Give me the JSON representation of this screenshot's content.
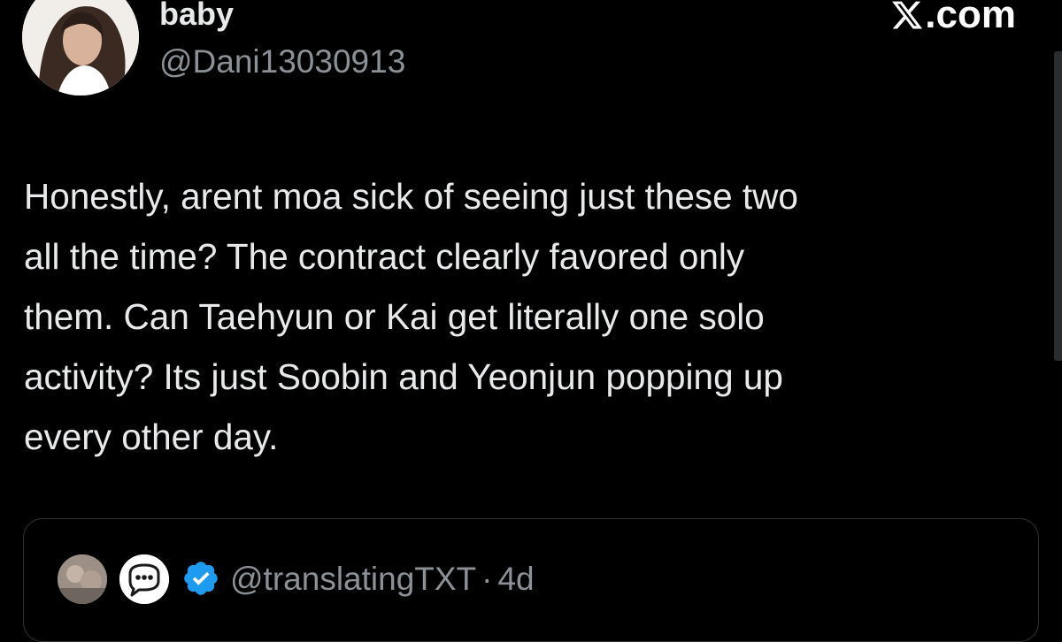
{
  "tweet": {
    "author": {
      "display_name": "baby",
      "handle": "@Dani13030913",
      "avatar_icon": "profile-photo"
    },
    "brand": {
      "logo_icon": "x-logo-icon",
      "domain_suffix": ".com"
    },
    "text": "Honestly, arent moa sick of seeing just these two\nall the time? The contract clearly favored only\nthem. Can Taehyun or Kai get literally one solo\nactivity? Its just Soobin and Yeonjun popping up\nevery other day."
  },
  "quoted_tweet": {
    "handle": "@translatingTXT",
    "separator": "·",
    "age": "4d",
    "verified": true,
    "verified_color": "#1d9bf0",
    "emoji_icon": "speech-bubble-icon"
  },
  "colors": {
    "background": "#000000",
    "primary_text": "#e7e9ea",
    "secondary_text": "#8b9197",
    "border": "#2f3336"
  }
}
